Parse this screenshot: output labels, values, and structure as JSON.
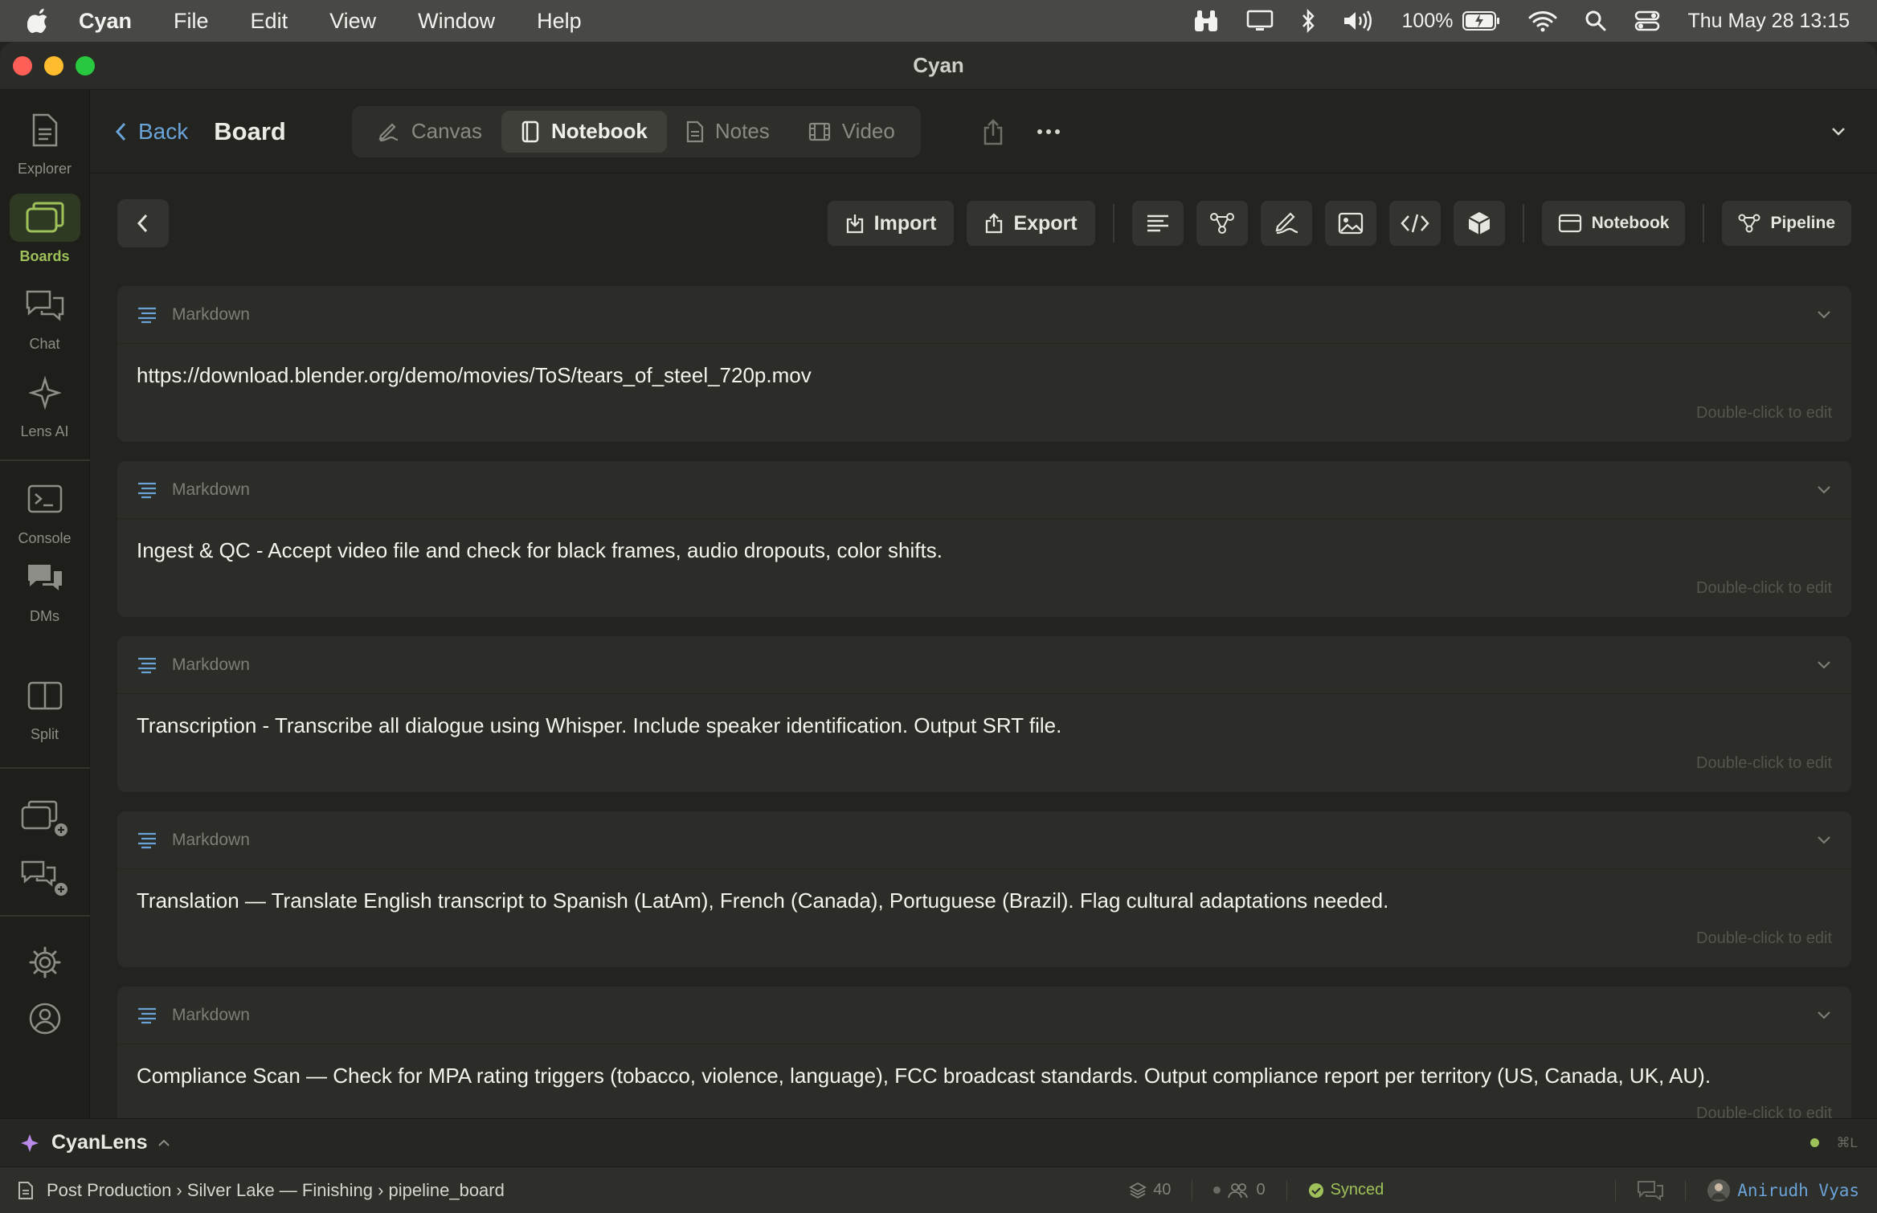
{
  "menubar": {
    "app": "Cyan",
    "items": [
      "File",
      "Edit",
      "View",
      "Window",
      "Help"
    ],
    "battery": "100%",
    "datetime": "Thu May 28  13:15"
  },
  "window": {
    "title": "Cyan"
  },
  "sidebar": {
    "items": [
      {
        "label": "Explorer",
        "icon": "document-icon"
      },
      {
        "label": "Boards",
        "icon": "boards-icon"
      },
      {
        "label": "Chat",
        "icon": "chat-icon"
      },
      {
        "label": "Lens AI",
        "icon": "sparkle-icon"
      },
      {
        "label": "Console",
        "icon": "terminal-icon"
      },
      {
        "label": "DMs",
        "icon": "dm-icon"
      },
      {
        "label": "Split",
        "icon": "split-icon"
      }
    ]
  },
  "header": {
    "back_label": "Back",
    "title": "Board",
    "tabs": [
      {
        "label": "Canvas"
      },
      {
        "label": "Notebook"
      },
      {
        "label": "Notes"
      },
      {
        "label": "Video"
      }
    ],
    "active_tab": "Notebook"
  },
  "toolbar": {
    "import_label": "Import",
    "export_label": "Export",
    "notebook_label": "Notebook",
    "pipeline_label": "Pipeline"
  },
  "cells": [
    {
      "type": "Markdown",
      "text": "https://download.blender.org/demo/movies/ToS/tears_of_steel_720p.mov",
      "hint": "Double-click to edit"
    },
    {
      "type": "Markdown",
      "text": "Ingest & QC - Accept video file and check for black frames, audio dropouts, color shifts.",
      "hint": "Double-click to edit"
    },
    {
      "type": "Markdown",
      "text": "Transcription - Transcribe all dialogue using Whisper. Include speaker identification. Output SRT file.",
      "hint": "Double-click to edit"
    },
    {
      "type": "Markdown",
      "text": "Translation — Translate English transcript to Spanish (LatAm), French (Canada), Portuguese (Brazil). Flag cultural adaptations needed.",
      "hint": "Double-click to edit"
    },
    {
      "type": "Markdown",
      "text": "Compliance Scan — Check for MPA rating triggers (tobacco, violence, language), FCC broadcast standards. Output compliance report per territory (US, Canada, UK, AU).",
      "hint": "Double-click to edit"
    }
  ],
  "lens": {
    "title": "CyanLens",
    "shortcut": "⌘L"
  },
  "status": {
    "breadcrumb": "Post Production › Silver Lake — Finishing › pipeline_board",
    "layers": "40",
    "members": "0",
    "sync": "Synced",
    "user": "Anirudh Vyas"
  },
  "colors": {
    "accent_green": "#9ec15a",
    "accent_blue": "#6aa3d8"
  }
}
